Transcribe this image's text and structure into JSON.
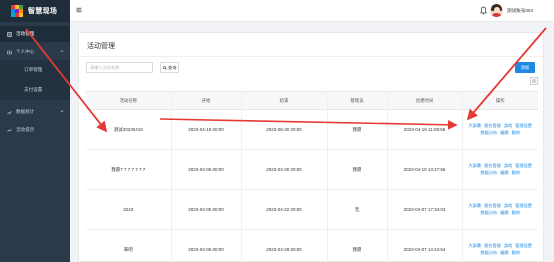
{
  "app": {
    "name": "智慧现场"
  },
  "sidebar": {
    "items": [
      {
        "label": "活动管理"
      },
      {
        "label": "个人中心"
      },
      {
        "label": "订单管理"
      },
      {
        "label": "支付设置"
      },
      {
        "label": "数据统计"
      },
      {
        "label": "活动提示"
      }
    ]
  },
  "header": {
    "username": "测试账号004"
  },
  "page": {
    "title": "活动管理",
    "search_placeholder": "请输入活动名称",
    "search_label": "查询",
    "add_label": "添加"
  },
  "table": {
    "columns": [
      "活动名称",
      "开始",
      "结束",
      "管理员",
      "创建时间",
      "操作"
    ],
    "rows": [
      {
        "name": "测试20230419",
        "start": "2023-04-19 00:00",
        "end": "2023-06-30 00:00",
        "admin": "我愿",
        "created": "2023-04-19 11:09:56",
        "ops": [
          "大屏幕",
          "报名管理",
          "游戏",
          "管理设置",
          "数据分析",
          "编辑",
          "删除"
        ]
      },
      {
        "name": "我愿7 7 7 7 7 7 7",
        "start": "2023-04-06 00:00",
        "end": "2023-04-30 00:00",
        "admin": "我愿",
        "created": "2023-04-10 13:47:56",
        "ops": [
          "大屏幕",
          "报名管理",
          "游戏",
          "管理设置",
          "数据分析",
          "编辑",
          "删除"
        ]
      },
      {
        "name": "3243",
        "start": "2023-04-05 00:00",
        "end": "2023-04-22 00:00",
        "admin": "无",
        "created": "2023-04-07 17:34:03",
        "ops": [
          "大屏幕",
          "报名管理",
          "游戏",
          "管理设置",
          "数据分析",
          "编辑",
          "删除"
        ]
      },
      {
        "name": "来吧",
        "start": "2023-04-06 00:00",
        "end": "2023-04-29 00:00",
        "admin": "我愿",
        "created": "2023-04-07 14:44:54",
        "ops": [
          "大屏幕",
          "报名管理",
          "游戏",
          "管理设置",
          "数据分析",
          "编辑",
          "删除"
        ]
      }
    ]
  },
  "colors": {
    "sidebar_bg": "#2b3a4a",
    "accent": "#1e88e5",
    "annotation": "#e53935"
  },
  "icons": [
    "logo-icon",
    "document-icon",
    "user-icon",
    "chart-icon",
    "bell-icon",
    "menu-toggle-icon",
    "search-icon",
    "grid-icon"
  ]
}
